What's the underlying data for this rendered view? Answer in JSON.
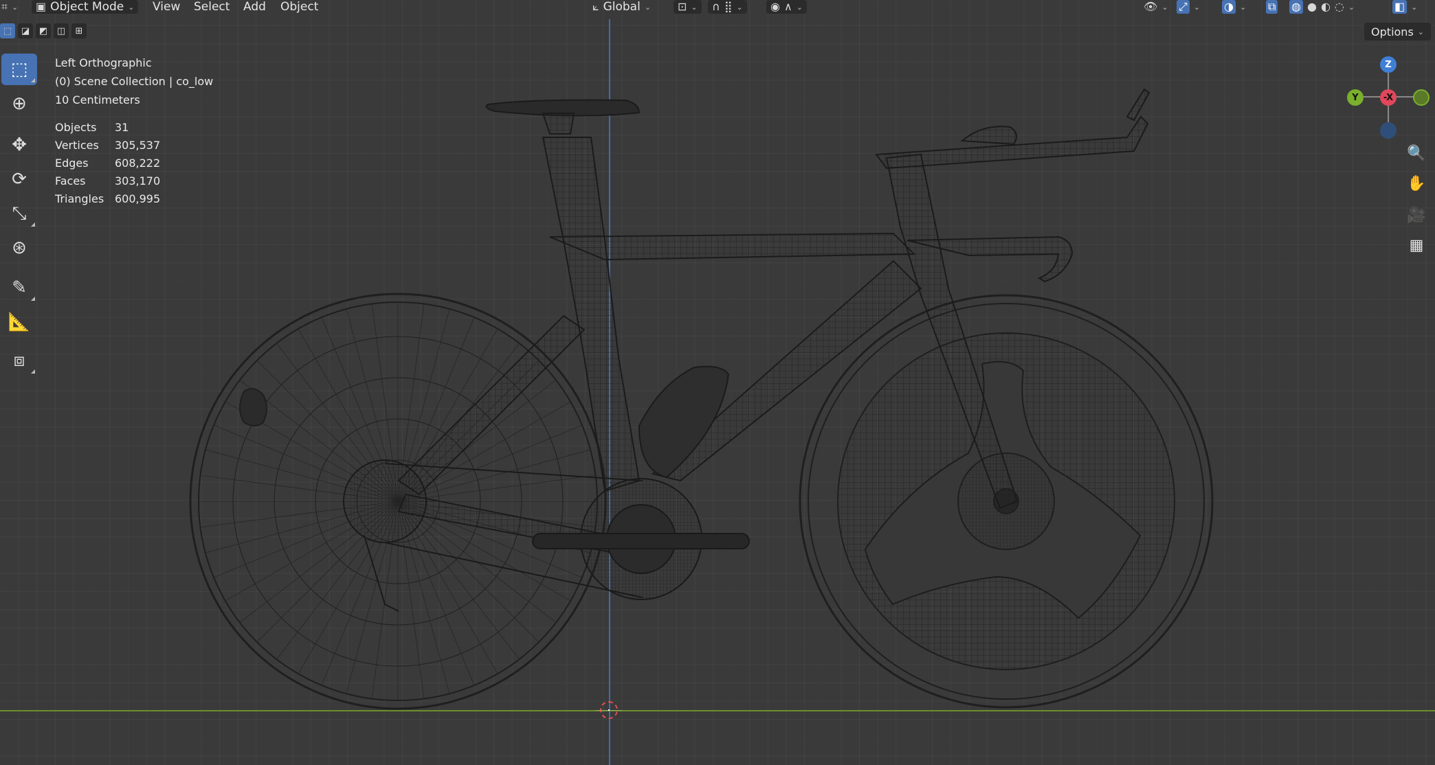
{
  "header": {
    "mode_label": "Object Mode",
    "menus": [
      "View",
      "Select",
      "Add",
      "Object"
    ],
    "orientation_label": "Global"
  },
  "options_label": "Options",
  "overlay": {
    "view_name": "Left Orthographic",
    "collection": "(0) Scene Collection | co_low",
    "scale": "10 Centimeters",
    "stats": [
      {
        "label": "Objects",
        "value": "31"
      },
      {
        "label": "Vertices",
        "value": "305,537"
      },
      {
        "label": "Edges",
        "value": "608,222"
      },
      {
        "label": "Faces",
        "value": "303,170"
      },
      {
        "label": "Triangles",
        "value": "600,995"
      }
    ]
  },
  "gizmo": {
    "z": "Z",
    "y": "Y",
    "x": "-X"
  },
  "tools": [
    "select-box-icon",
    "cursor-icon",
    "move-icon",
    "rotate-icon",
    "scale-icon",
    "transform-icon",
    "annotate-icon",
    "measure-icon",
    "add-cube-icon"
  ],
  "colors": {
    "viewport": "#3a3a3a",
    "accent": "#4772b3",
    "z_axis": "#3f6fb5",
    "y_axis": "#6c8f2c",
    "x_red": "#e0475b"
  }
}
